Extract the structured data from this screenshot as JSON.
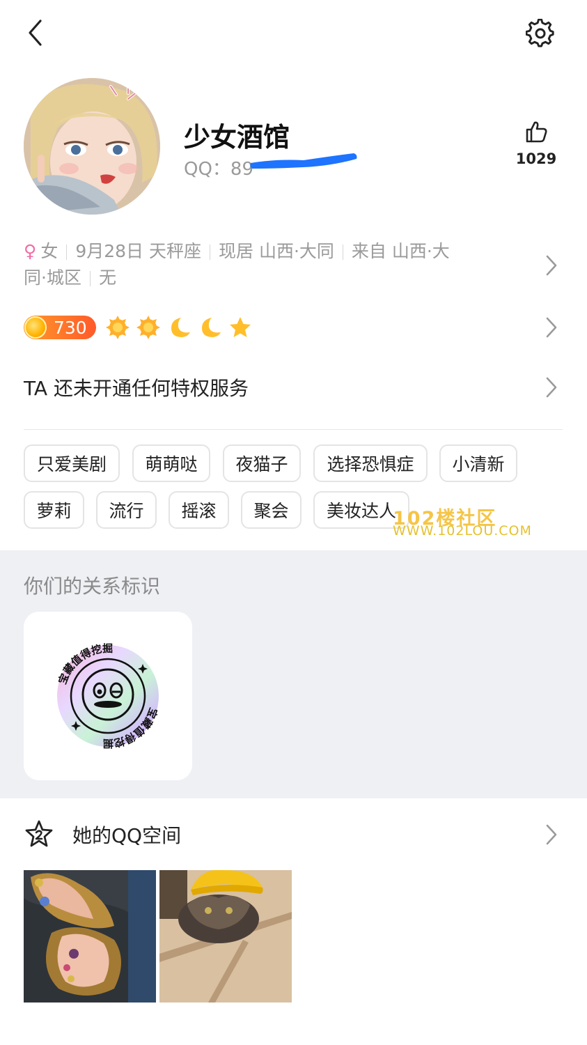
{
  "header": {
    "back_icon": "chevron-left-icon",
    "settings_icon": "gear-icon"
  },
  "profile": {
    "nickname": "少女酒馆",
    "qq_label": "QQ：89",
    "likes": "1029",
    "like_icon": "thumbs-up-icon"
  },
  "info": {
    "gender_symbol": "♀",
    "gender": "女",
    "birthday": "9月28日 天秤座",
    "residence": "现居 山西·大同",
    "hometown_part1": "来自 山西·大",
    "hometown_part2": "同·城区",
    "extra": "无"
  },
  "level": {
    "value": "730",
    "icons": [
      "sun-icon",
      "sun-icon",
      "moon-icon",
      "moon-icon",
      "star-icon"
    ]
  },
  "privilege": {
    "text": "TA 还未开通任何特权服务"
  },
  "tags": [
    "只爱美剧",
    "萌萌哒",
    "夜猫子",
    "选择恐惧症",
    "小清新",
    "萝莉",
    "流行",
    "摇滚",
    "聚会",
    "美妆达人"
  ],
  "watermark": {
    "line1": "102楼社区",
    "line2": "WWW.102LOU.COM"
  },
  "relationship": {
    "title": "你们的关系标识",
    "badge_text": "宝藏值得挖掘"
  },
  "qzone": {
    "title": "她的QQ空间",
    "icon": "star-2-icon"
  },
  "colors": {
    "accent_female": "#f06da8",
    "level_orange": "#ff7a2a",
    "gray_bg": "#eff0f4"
  }
}
